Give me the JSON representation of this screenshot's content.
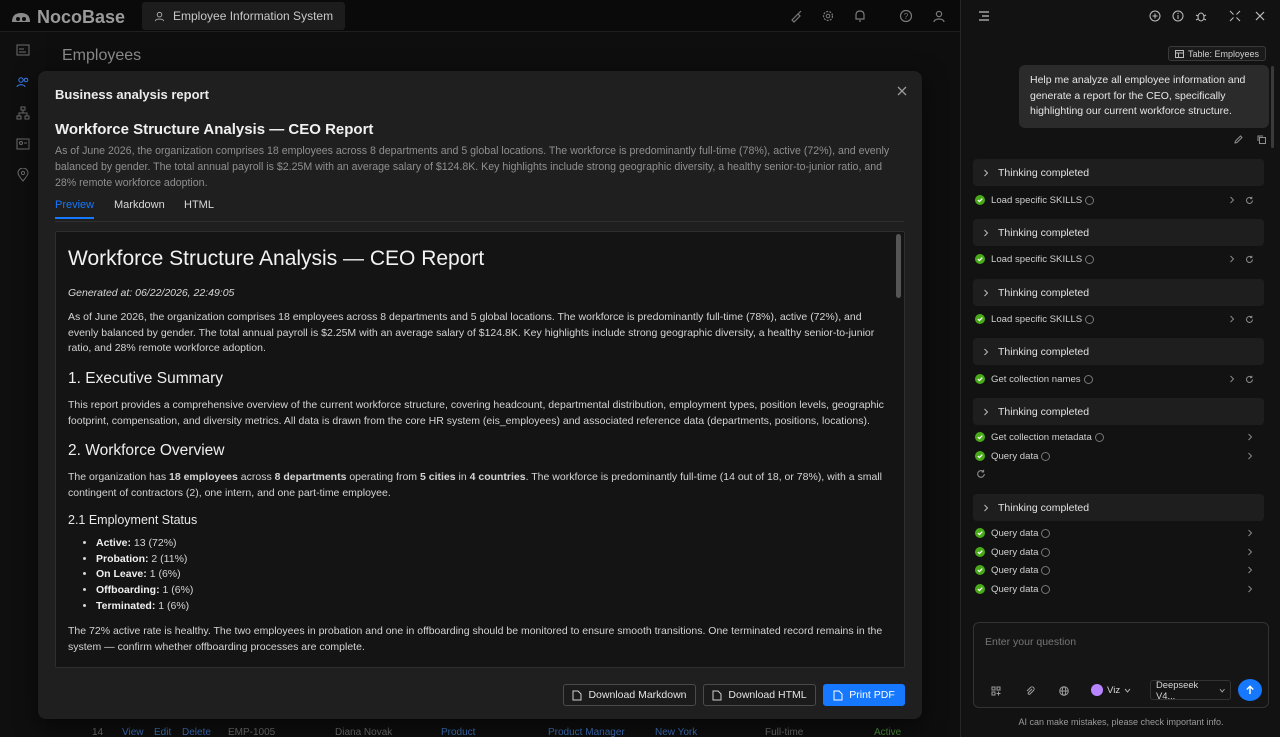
{
  "app": {
    "logo_text": "NocoBase",
    "tab_label": "Employee Information System"
  },
  "top_icons": [
    "brush-icon",
    "gear-icon",
    "bell-icon",
    "help-icon",
    "user-icon"
  ],
  "rail_icons": [
    "profile-card-icon",
    "users-icon",
    "org-chart-icon",
    "id-card-icon",
    "location-pin-icon"
  ],
  "page": {
    "title": "Employees",
    "bg_row": {
      "number": "14",
      "view": "View",
      "edit": "Edit",
      "delete": "Delete",
      "code": "EMP-1005",
      "name": "Diana Novak",
      "dept": "Product",
      "position": "Product Manager",
      "city": "New York",
      "type": "Full-time",
      "status": "Active"
    }
  },
  "modal": {
    "title": "Business analysis report",
    "report_heading": "Workforce Structure Analysis — CEO Report",
    "summary": "As of June 2026, the organization comprises 18 employees across 8 departments and 5 global locations. The workforce is predominantly full-time (78%), active (72%), and evenly balanced by gender. The total annual payroll is $2.25M with an average salary of $124.8K. Key highlights include strong geographic diversity, a healthy senior-to-junior ratio, and 28% remote workforce adoption.",
    "tabs": [
      "Preview",
      "Markdown",
      "HTML"
    ],
    "preview": {
      "h1": "Workforce Structure Analysis — CEO Report",
      "generated": "Generated at: 06/22/2026, 22:49:05",
      "intro": "As of June 2026, the organization comprises 18 employees across 8 departments and 5 global locations. The workforce is predominantly full-time (78%), active (72%), and evenly balanced by gender. The total annual payroll is $2.25M with an average salary of $124.8K. Key highlights include strong geographic diversity, a healthy senior-to-junior ratio, and 28% remote workforce adoption.",
      "s1_title": "1. Executive Summary",
      "s1_text": "This report provides a comprehensive overview of the current workforce structure, covering headcount, departmental distribution, employment types, position levels, geographic footprint, compensation, and diversity metrics. All data is drawn from the core HR system (eis_employees) and associated reference data (departments, positions, locations).",
      "s2_title": "2. Workforce Overview",
      "s2_p1": "The organization has ",
      "s2_b1": "18 employees",
      "s2_p2": " across ",
      "s2_b2": "8 departments",
      "s2_p3": " operating from ",
      "s2_b3": "5 cities",
      "s2_p4": " in ",
      "s2_b4": "4 countries",
      "s2_p5": ". The workforce is predominantly full-time (14 out of 18, or 78%), with a small contingent of contractors (2), one intern, and one part-time employee.",
      "s21_title": "2.1 Employment Status",
      "status_items": [
        {
          "label": "Active:",
          "value": " 13 (72%)"
        },
        {
          "label": "Probation:",
          "value": " 2 (11%)"
        },
        {
          "label": "On Leave:",
          "value": " 1 (6%)"
        },
        {
          "label": "Offboarding:",
          "value": " 1 (6%)"
        },
        {
          "label": "Terminated:",
          "value": " 1 (6%)"
        }
      ],
      "status_note": "The 72% active rate is healthy. The two employees in probation and one in offboarding should be monitored to ensure smooth transitions. One terminated record remains in the system — confirm whether offboarding processes are complete."
    },
    "buttons": {
      "download_md": "Download Markdown",
      "download_html": "Download HTML",
      "print_pdf": "Print PDF"
    }
  },
  "chat": {
    "header_icons": [
      "menu-icon",
      "new-chat-icon",
      "info-icon",
      "bug-icon",
      "collapse-icon",
      "close-icon"
    ],
    "context_tag": "Table: Employees",
    "user_message": "Help me analyze all employee information and generate a report for the CEO, specifically highlighting our current workforce structure.",
    "thinking_label": "Thinking completed",
    "tools": {
      "load_skills": "Load specific SKILLS",
      "collection_names": "Get collection names",
      "collection_metadata": "Get collection metadata",
      "query_data": "Query data"
    },
    "input_placeholder": "Enter your question",
    "agent": "Viz",
    "model": "Deepseek V4...",
    "disclaimer": "AI can make mistakes, please check important info."
  }
}
